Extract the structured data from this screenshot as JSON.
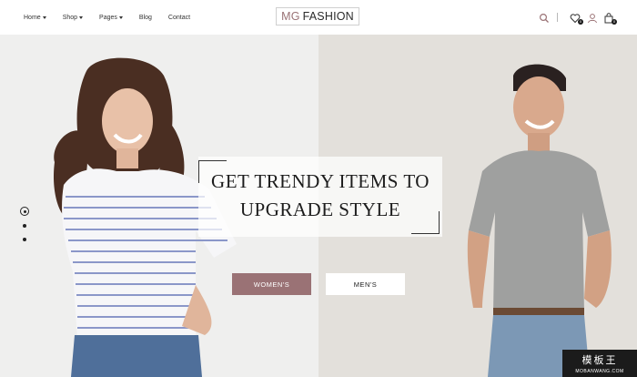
{
  "nav": {
    "items": [
      {
        "label": "Home",
        "has_dropdown": true
      },
      {
        "label": "Shop",
        "has_dropdown": true
      },
      {
        "label": "Pages",
        "has_dropdown": true
      },
      {
        "label": "Blog",
        "has_dropdown": false
      },
      {
        "label": "Contact",
        "has_dropdown": false
      }
    ]
  },
  "logo": {
    "prefix": "MG",
    "name": "FASHION"
  },
  "header_icons": {
    "search": "search-icon",
    "wishlist": {
      "icon": "heart-icon",
      "count": "0"
    },
    "account": "user-icon",
    "cart": {
      "icon": "shopping-bag-icon",
      "count": "0"
    }
  },
  "hero": {
    "headline_line1": "GET TRENDY ITEMS TO",
    "headline_line2": "UPGRADE STYLE",
    "button_women": "WOMEN'S",
    "button_men": "MEN'S",
    "slide_count": 3,
    "active_slide": 1
  },
  "watermark": {
    "top": "模板王",
    "bottom": "MOBANWANG.COM"
  },
  "colors": {
    "accent": "#9a7275",
    "text": "#222222",
    "left_bg": "#efefee",
    "right_bg": "#e3e0db"
  }
}
